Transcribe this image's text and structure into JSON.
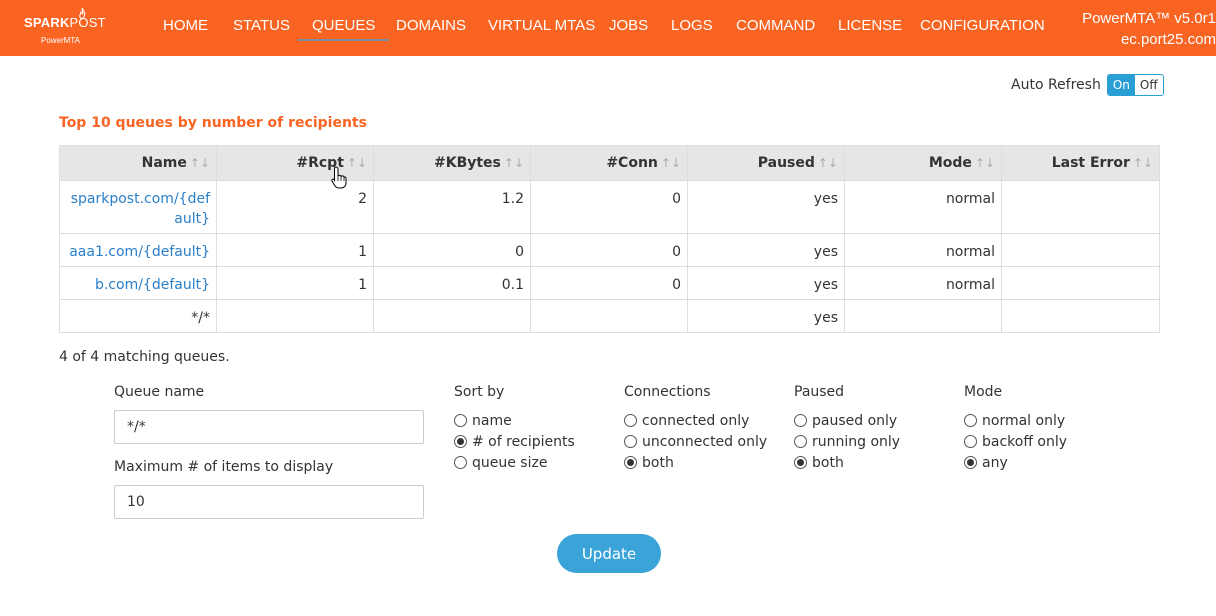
{
  "brand": {
    "logo_main": "SPARK",
    "logo_thin": "POST",
    "logo_sub": "PowerMTA",
    "version": "PowerMTA™ v5.0r1",
    "host": "ec.port25.com"
  },
  "nav": [
    "HOME",
    "STATUS",
    "QUEUES",
    "DOMAINS",
    "VIRTUAL MTAS",
    "JOBS",
    "LOGS",
    "COMMAND",
    "LICENSE",
    "CONFIGURATION"
  ],
  "nav_active": "QUEUES",
  "auto_refresh": {
    "label": "Auto Refresh",
    "on": "On",
    "off": "Off",
    "selected": "On"
  },
  "section_title": "Top 10 queues by number of recipients",
  "table": {
    "sort_glyph": "↑↓",
    "columns": [
      "Name",
      "#Rcpt",
      "#KBytes",
      "#Conn",
      "Paused",
      "Mode",
      "Last Error"
    ],
    "rows": [
      {
        "name": "sparkpost.com/{default}",
        "rcpt": "2",
        "kbytes": "1.2",
        "conn": "0",
        "paused": "yes",
        "mode": "normal",
        "last_error": ""
      },
      {
        "name": "aaa1.com/{default}",
        "rcpt": "1",
        "kbytes": "0",
        "conn": "0",
        "paused": "yes",
        "mode": "normal",
        "last_error": ""
      },
      {
        "name": "b.com/{default}",
        "rcpt": "1",
        "kbytes": "0.1",
        "conn": "0",
        "paused": "yes",
        "mode": "normal",
        "last_error": ""
      },
      {
        "name": "*/*",
        "rcpt": "",
        "kbytes": "",
        "conn": "",
        "paused": "yes",
        "mode": "",
        "last_error": ""
      }
    ]
  },
  "matching_text": "4 of 4 matching queues.",
  "form": {
    "queue_name_label": "Queue name",
    "queue_name_value": "*/*",
    "max_items_label": "Maximum # of items to display",
    "max_items_value": "10",
    "sort_by": {
      "label": "Sort by",
      "options": [
        "name",
        "# of recipients",
        "queue size"
      ],
      "selected": "# of recipients"
    },
    "connections": {
      "label": "Connections",
      "options": [
        "connected only",
        "unconnected only",
        "both"
      ],
      "selected": "both"
    },
    "paused": {
      "label": "Paused",
      "options": [
        "paused only",
        "running only",
        "both"
      ],
      "selected": "both"
    },
    "mode": {
      "label": "Mode",
      "options": [
        "normal only",
        "backoff only",
        "any"
      ],
      "selected": "any"
    },
    "update_label": "Update"
  },
  "colors": {
    "brand_orange": "#fa6423",
    "accent_blue": "#2a9fd6",
    "link_blue": "#2a7fc9",
    "button_blue": "#3aa3d8"
  }
}
